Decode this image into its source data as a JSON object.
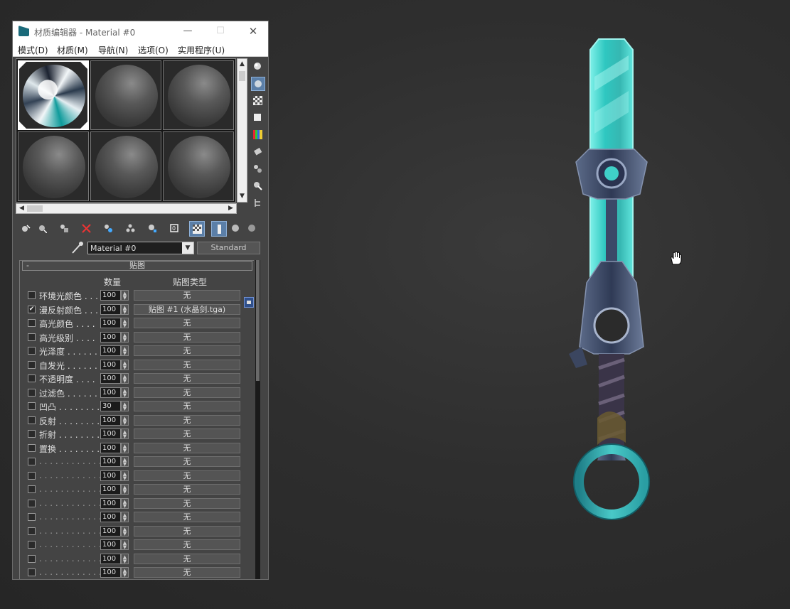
{
  "window": {
    "title": "材质编辑器 - Material #0",
    "min_icon": "minimize-icon",
    "max_icon": "maximize-icon",
    "close_icon": "close-icon"
  },
  "menu": [
    "模式(D)",
    "材质(M)",
    "导航(N)",
    "选项(O)",
    "实用程序(U)"
  ],
  "material": {
    "name": "Material #0",
    "type": "Standard"
  },
  "rollout": {
    "title": "贴图",
    "collapse": "-",
    "header_amount": "数量",
    "header_type": "贴图类型"
  },
  "maps": [
    {
      "label": "环境光颜色 . . .",
      "checked": false,
      "amount": "100",
      "map": "无"
    },
    {
      "label": "漫反射颜色 . . .",
      "checked": true,
      "amount": "100",
      "map": "贴图 #1 (水晶剑.tga)"
    },
    {
      "label": "高光颜色 . . . .",
      "checked": false,
      "amount": "100",
      "map": "无"
    },
    {
      "label": "高光级别 . . . .",
      "checked": false,
      "amount": "100",
      "map": "无"
    },
    {
      "label": "光泽度 . . . . . .",
      "checked": false,
      "amount": "100",
      "map": "无"
    },
    {
      "label": "自发光 . . . . . .",
      "checked": false,
      "amount": "100",
      "map": "无"
    },
    {
      "label": "不透明度 . . . .",
      "checked": false,
      "amount": "100",
      "map": "无"
    },
    {
      "label": "过滤色 . . . . . .",
      "checked": false,
      "amount": "100",
      "map": "无"
    },
    {
      "label": "凹凸 . . . . . . . .",
      "checked": false,
      "amount": "30",
      "map": "无"
    },
    {
      "label": "反射 . . . . . . . .",
      "checked": false,
      "amount": "100",
      "map": "无"
    },
    {
      "label": "折射 . . . . . . . .",
      "checked": false,
      "amount": "100",
      "map": "无"
    },
    {
      "label": "置换 . . . . . . . .",
      "checked": false,
      "amount": "100",
      "map": "无"
    },
    {
      "label": ". . . . . . . . . . . .",
      "checked": false,
      "amount": "100",
      "map": "无"
    },
    {
      "label": ". . . . . . . . . . . .",
      "checked": false,
      "amount": "100",
      "map": "无"
    },
    {
      "label": ". . . . . . . . . . . .",
      "checked": false,
      "amount": "100",
      "map": "无"
    },
    {
      "label": ". . . . . . . . . . . .",
      "checked": false,
      "amount": "100",
      "map": "无"
    },
    {
      "label": ". . . . . . . . . . . .",
      "checked": false,
      "amount": "100",
      "map": "无"
    },
    {
      "label": ". . . . . . . . . . . .",
      "checked": false,
      "amount": "100",
      "map": "无"
    },
    {
      "label": ". . . . . . . . . . . .",
      "checked": false,
      "amount": "100",
      "map": "无"
    },
    {
      "label": ". . . . . . . . . . . .",
      "checked": false,
      "amount": "100",
      "map": "无"
    },
    {
      "label": ". . . . . . . . . . . .",
      "checked": false,
      "amount": "100",
      "map": "无"
    }
  ],
  "side_tools": [
    "sample-type-icon",
    "backlight-icon",
    "background-checker-icon",
    "sample-uv-icon",
    "video-color-check-icon",
    "make-preview-icon",
    "options-icon",
    "select-by-material-icon",
    "material-map-navigator-icon"
  ],
  "bottom_tools": [
    "get-material-icon",
    "put-to-scene-icon",
    "assign-to-selection-icon",
    "reset-map-icon",
    "make-copy-icon",
    "make-unique-icon",
    "put-to-library-icon",
    "material-id-channel-icon",
    "show-map-in-viewport-icon",
    "show-end-result-icon",
    "go-to-parent-icon",
    "go-forward-to-sibling-icon"
  ],
  "colors": {
    "window_bg": "#444444",
    "accent": "#5b7fa8",
    "sword_blade": "#3fd0c8",
    "sword_metal": "#3d4a66"
  }
}
